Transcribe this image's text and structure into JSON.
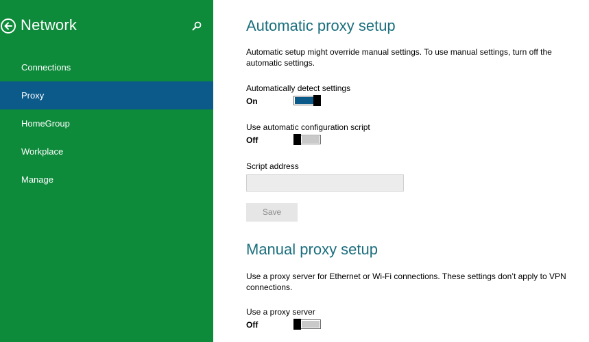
{
  "sidebar": {
    "title": "Network",
    "items": [
      {
        "label": "Connections"
      },
      {
        "label": "Proxy"
      },
      {
        "label": "HomeGroup"
      },
      {
        "label": "Workplace"
      },
      {
        "label": "Manage"
      }
    ],
    "active_index": 1,
    "icons": {
      "back": "back-arrow-icon",
      "search": "search-icon"
    }
  },
  "automatic": {
    "title": "Automatic proxy setup",
    "description": "Automatic setup might override manual settings. To use manual settings, turn off the automatic settings.",
    "detect": {
      "label": "Automatically detect settings",
      "state": "On"
    },
    "script": {
      "label": "Use automatic configuration script",
      "state": "Off"
    },
    "address": {
      "label": "Script address",
      "value": ""
    },
    "save_label": "Save"
  },
  "manual": {
    "title": "Manual proxy setup",
    "description": "Use a proxy server for Ethernet or Wi-Fi connections. These settings don’t apply to VPN connections.",
    "proxy": {
      "label": "Use a proxy server",
      "state": "Off"
    }
  },
  "colors": {
    "sidebar_bg": "#0d8a3a",
    "active_item_bg": "#0b5a8a",
    "title_text": "#1a6e7d",
    "toggle_on": "#0b5a8a",
    "toggle_off": "#c9c9c9"
  }
}
